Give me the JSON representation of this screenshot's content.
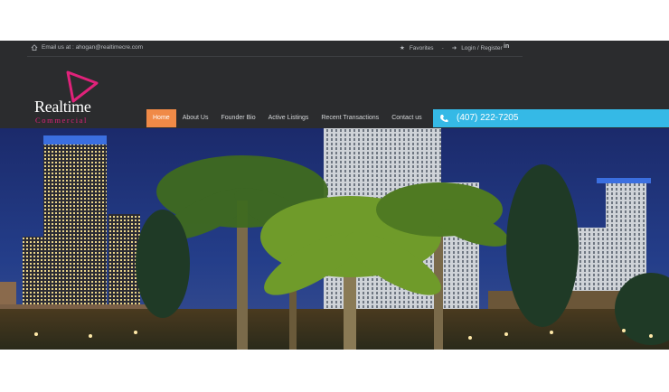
{
  "topbar": {
    "email_label": "Email us at : ahogan@realtimecre.com",
    "favorites_label": "Favorites",
    "separator": "-",
    "login_label": "Login / Register",
    "linkedin_label": "in"
  },
  "brand": {
    "name_line1": "Realtime",
    "name_line2": "Commercial",
    "accent_color": "#e0227a"
  },
  "nav": {
    "items": [
      {
        "label": "Home",
        "active": true
      },
      {
        "label": "About Us",
        "active": false
      },
      {
        "label": "Founder Bio",
        "active": false
      },
      {
        "label": "Active Listings",
        "active": false
      },
      {
        "label": "Recent Transactions",
        "active": false
      },
      {
        "label": "Contact us",
        "active": false
      }
    ],
    "active_color": "#f08a47"
  },
  "contact": {
    "phone": "(407) 222-7205",
    "bar_color": "#35b9e6"
  },
  "hero": {
    "image": "night city skyline with palm trees"
  }
}
